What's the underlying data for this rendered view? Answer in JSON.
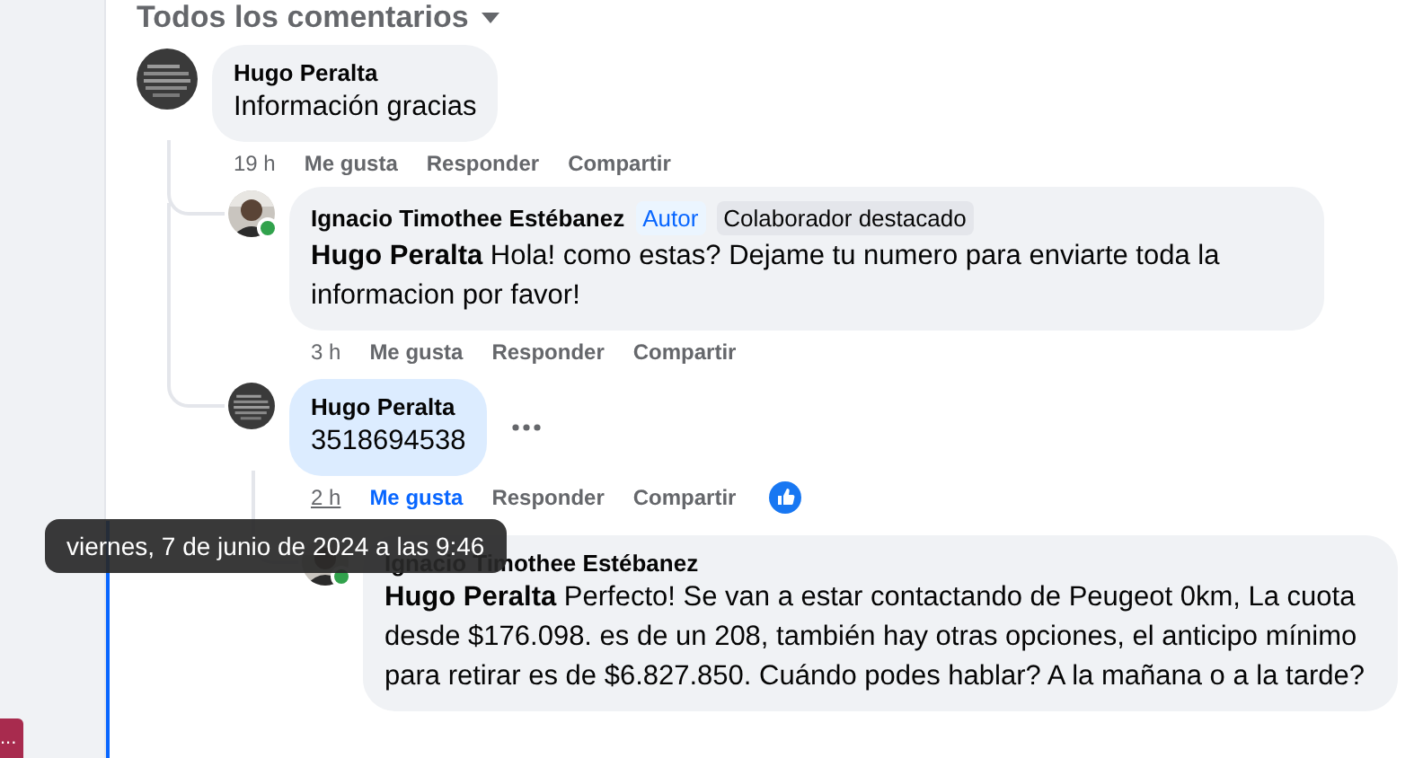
{
  "header": {
    "title": "Todos los comentarios"
  },
  "comments": [
    {
      "kind": "commenter",
      "author": "Hugo Peralta",
      "text": "Información gracias",
      "time": "19 h",
      "actions": [
        "Me gusta",
        "Responder",
        "Compartir"
      ],
      "children": [
        {
          "kind": "page-author",
          "author": "Ignacio Timothee Estébanez",
          "online": true,
          "badges": [
            {
              "text": "Autor",
              "kind": "author"
            },
            {
              "text": "Colaborador destacado",
              "kind": "featured"
            }
          ],
          "text": "**Hugo Peralta** Hola! como estas? Dejame tu numero para enviarte toda la informacion por favor!",
          "time": "3 h",
          "actions": [
            "Me gusta",
            "Responder",
            "Compartir"
          ]
        },
        {
          "kind": "commenter",
          "author": "Hugo Peralta",
          "text": "3518694538",
          "highlighted": true,
          "more": true,
          "time": "2 h",
          "time_hovered": true,
          "liked": true,
          "reaction": true,
          "actions": [
            "Me gusta",
            "Responder",
            "Compartir"
          ],
          "children": [
            {
              "kind": "page-author",
              "author": "Ignacio Timothee Estébanez",
              "online": true,
              "text": "**Hugo Peralta** Perfecto! Se van a estar contactando de Peugeot 0km, La cuota desde $176.098. es de un 208, también hay otras opciones, el anticipo mínimo para retirar es de $6.827.850. Cuándo podes hablar? A la mañana o a la tarde?"
            }
          ]
        }
      ]
    }
  ],
  "tooltip": {
    "text": "viernes, 7 de junio de 2024 a las 9:46"
  },
  "side_button": {
    "label": "..."
  }
}
